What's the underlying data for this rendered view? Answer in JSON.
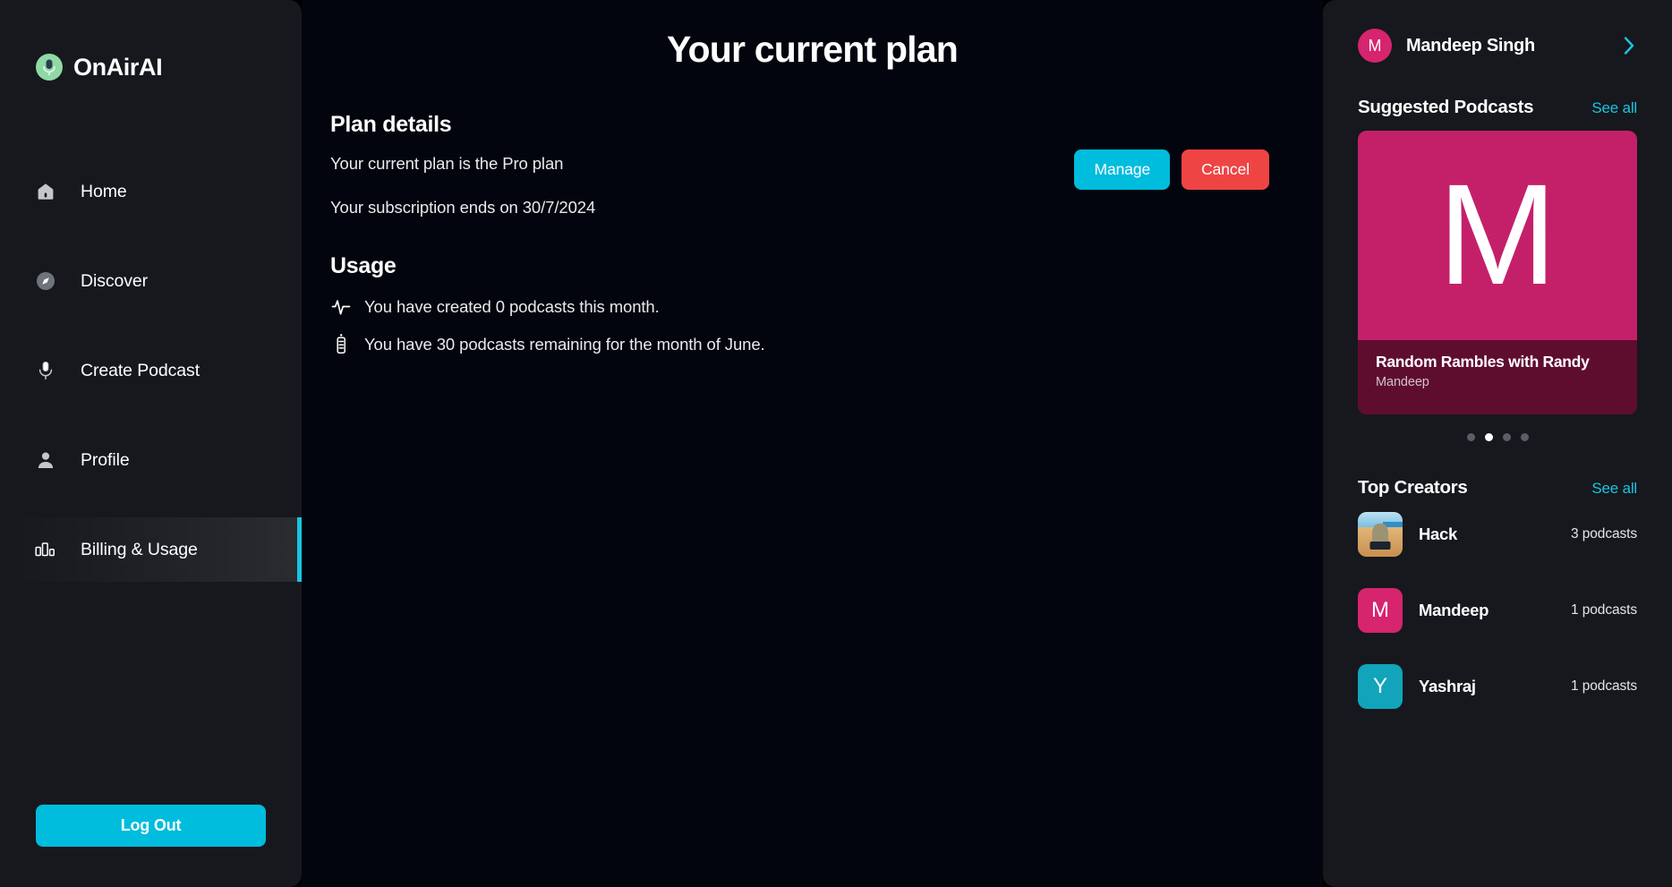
{
  "brand": {
    "name": "OnAirAI",
    "logo_icon": "microphone-circle-icon",
    "accent": "#8ed9a5"
  },
  "sidebar": {
    "items": [
      {
        "label": "Home",
        "icon": "home-icon",
        "active": false
      },
      {
        "label": "Discover",
        "icon": "compass-icon",
        "active": false
      },
      {
        "label": "Create Podcast",
        "icon": "microphone-icon",
        "active": false
      },
      {
        "label": "Profile",
        "icon": "person-icon",
        "active": false
      },
      {
        "label": "Billing & Usage",
        "icon": "bar-chart-icon",
        "active": true
      }
    ],
    "logout_label": "Log Out",
    "active_accent": "#18c6e0"
  },
  "main": {
    "page_title": "Your current plan",
    "plan": {
      "heading": "Plan details",
      "current_plan_line": "Your current plan is the Pro plan",
      "subscription_line": "Your subscription ends on 30/7/2024",
      "manage_label": "Manage",
      "cancel_label": "Cancel",
      "manage_color": "#00bcdd",
      "cancel_color": "#ef4444"
    },
    "usage": {
      "heading": "Usage",
      "rows": [
        {
          "icon": "activity-pulse-icon",
          "text": "You have created 0 podcasts this month."
        },
        {
          "icon": "battery-icon",
          "text": "You have 30 podcasts remaining for the month of June."
        }
      ]
    }
  },
  "rightpanel": {
    "user": {
      "name": "Mandeep Singh",
      "initial": "M",
      "avatar_color": "#d6246e",
      "chevron_icon": "chevron-right-icon"
    },
    "suggested": {
      "title": "Suggested Podcasts",
      "see_all": "See all",
      "card": {
        "letter": "M",
        "title": "Random Rambles with Randy",
        "author": "Mandeep",
        "bg_color": "#c4206a"
      },
      "dots": {
        "count": 4,
        "active_index": 1
      }
    },
    "creators": {
      "title": "Top Creators",
      "see_all": "See all",
      "items": [
        {
          "name": "Hack",
          "count": "3 podcasts",
          "avatar_type": "photo",
          "initial": "",
          "avatar_color": "#d9a86a"
        },
        {
          "name": "Mandeep",
          "count": "1 podcasts",
          "avatar_type": "letter",
          "initial": "M",
          "avatar_color": "#d6246e"
        },
        {
          "name": "Yashraj",
          "count": "1 podcasts",
          "avatar_type": "letter",
          "initial": "Y",
          "avatar_color": "#11a4bb"
        }
      ]
    }
  }
}
